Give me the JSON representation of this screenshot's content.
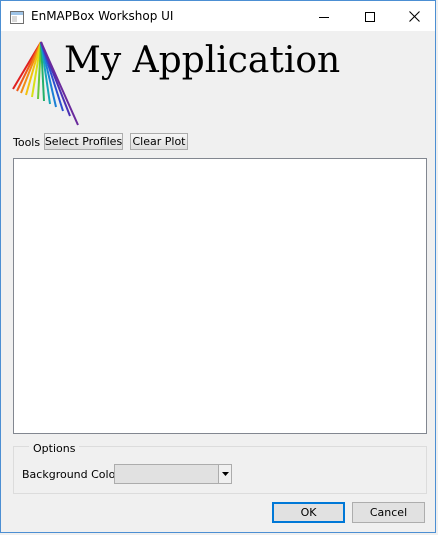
{
  "window": {
    "title": "EnMAPBox Workshop UI"
  },
  "header": {
    "heading": "My Application"
  },
  "tools": {
    "label": "Tools",
    "select_profiles_label": "Select Profiles",
    "clear_plot_label": "Clear Plot"
  },
  "options": {
    "group_title": "Options",
    "background_color_label": "Background Color",
    "background_color_value": "#e1e1e1"
  },
  "dialog": {
    "ok_label": "OK",
    "cancel_label": "Cancel"
  },
  "icons": {
    "app": "app-window-icon",
    "minimize": "minimize-icon",
    "maximize": "maximize-icon",
    "close": "close-icon",
    "logo": "enmap-spectral-logo",
    "dropdown": "dropdown-arrow-icon"
  },
  "colors": {
    "window_border": "#4c8fd3",
    "focus_border": "#0078d7",
    "dialog_bg": "#f0f0f0",
    "plot_bg": "#ffffff"
  }
}
